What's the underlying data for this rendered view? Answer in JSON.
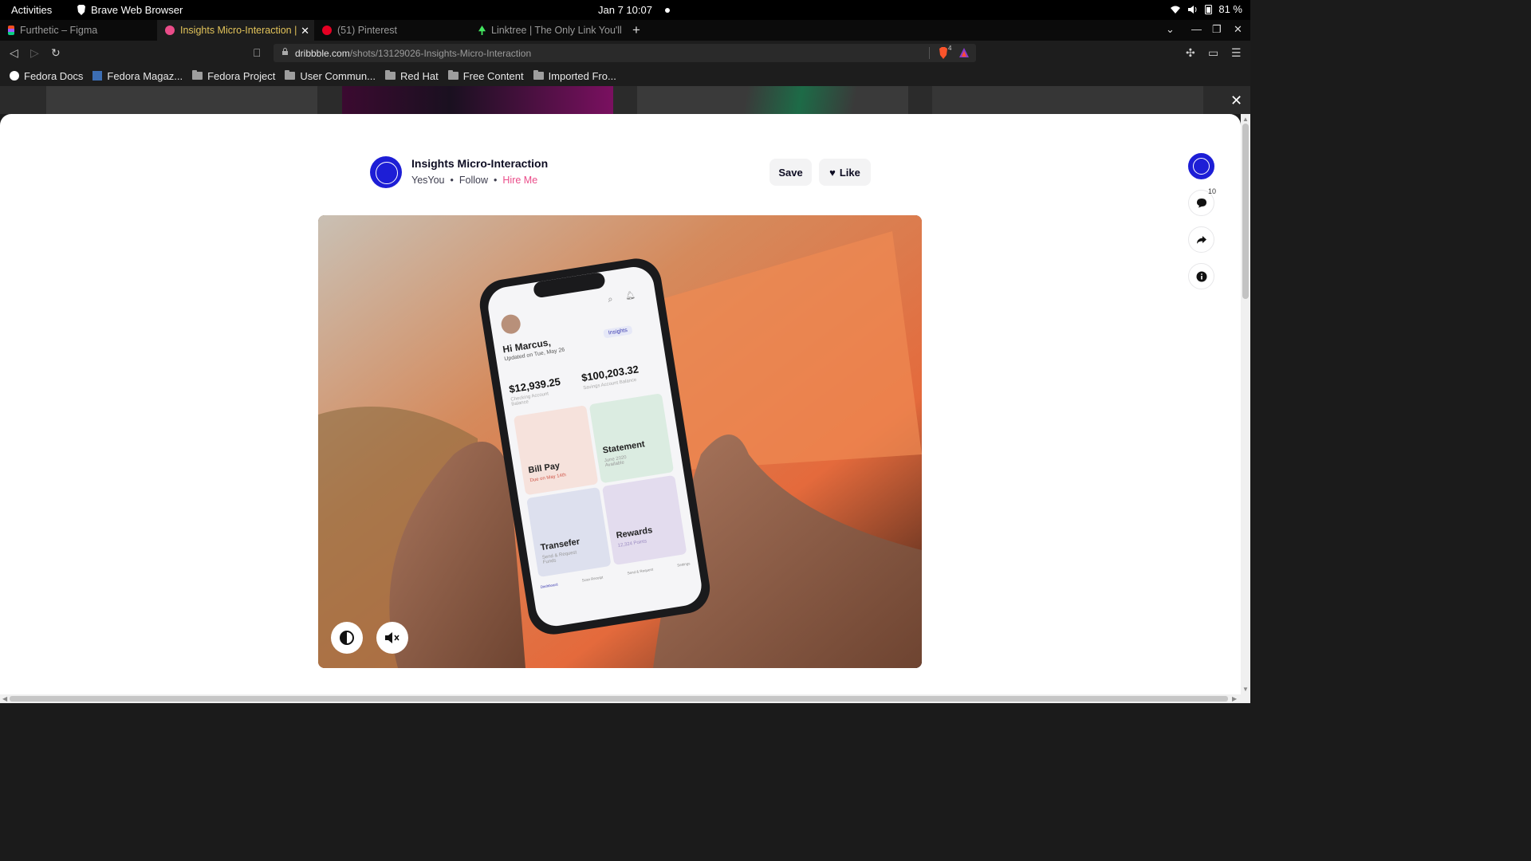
{
  "system": {
    "activities": "Activities",
    "app_name": "Brave Web Browser",
    "clock": "Jan 7  10:07",
    "battery": "81 %"
  },
  "tabs": [
    {
      "label": "Furthetic – Figma",
      "active": false
    },
    {
      "label": "Insights Micro-Interaction |",
      "active": true
    },
    {
      "label": "(51) Pinterest",
      "active": false
    },
    {
      "label": "Linktree | The Only Link You'll",
      "active": false
    }
  ],
  "address_bar": {
    "domain": "dribbble.com",
    "path": "/shots/13129026-Insights-Micro-Interaction",
    "brave_shield_count": "4"
  },
  "bookmarks": [
    {
      "label": "Fedora Docs",
      "icon": "fedora-icon"
    },
    {
      "label": "Fedora Magaz...",
      "icon": "fedora-magazine-icon"
    },
    {
      "label": "Fedora Project",
      "icon": "folder-icon"
    },
    {
      "label": "User Commun...",
      "icon": "folder-icon"
    },
    {
      "label": "Red Hat",
      "icon": "folder-icon"
    },
    {
      "label": "Free Content",
      "icon": "folder-icon"
    },
    {
      "label": "Imported Fro...",
      "icon": "folder-icon"
    }
  ],
  "shot": {
    "title": "Insights Micro-Interaction",
    "author": "YesYou",
    "follow": "Follow",
    "hire": "Hire Me",
    "save": "Save",
    "like": "Like",
    "comment_count": "10",
    "accent": "#ea4c89",
    "brand_blue": "#1d1ed6"
  },
  "phone_screen": {
    "greeting": "Hi Marcus,",
    "updated": "Updated on Tue, May 26",
    "insights_chip": "Insights",
    "checking_amount": "$12,939.25",
    "checking_label": "Checking Account Balance",
    "savings_amount": "$100,203.32",
    "savings_label": "Savings Account Balance",
    "tiles": [
      {
        "title": "Bill Pay",
        "sub": "Due on May 14th"
      },
      {
        "title": "Statement",
        "sub": "June 2020 Available"
      },
      {
        "title": "Transefer",
        "sub": "Send & Request Funds"
      },
      {
        "title": "Rewards",
        "sub": "12,324 Points"
      }
    ],
    "nav": [
      "Dashboard",
      "Scan Receipt",
      "Send & Request",
      "Settings"
    ]
  }
}
